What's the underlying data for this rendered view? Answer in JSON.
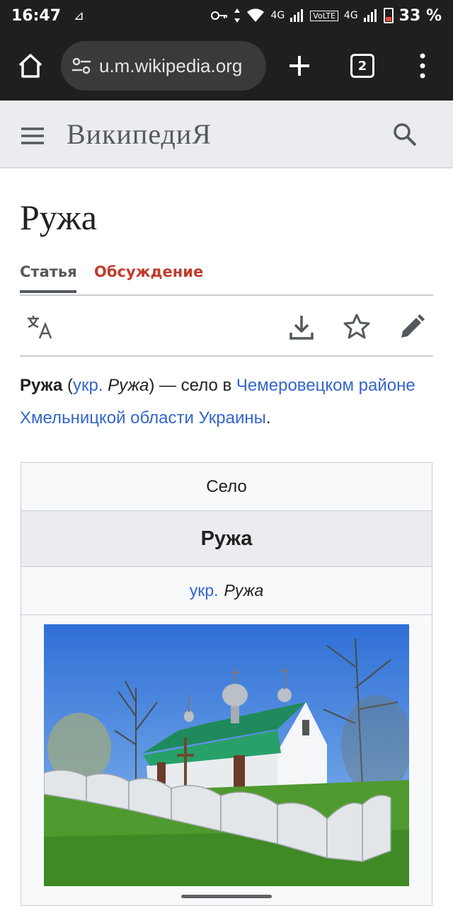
{
  "status_bar": {
    "time": "16:47",
    "speed_glyph": "⊿",
    "network_1": "4G",
    "volte": "VoLTE",
    "network_2": "4G",
    "battery_pct": "33 %",
    "battery_level": 0.33
  },
  "browser": {
    "url": "u.m.wikipedia.org",
    "tab_count": "2"
  },
  "wiki_header": {
    "logo_text": "ВикипедиЯ"
  },
  "article": {
    "title": "Ружа",
    "tabs": [
      {
        "label": "Статья"
      },
      {
        "label": "Обсуждение"
      }
    ],
    "lead": {
      "bold_name": "Ружа",
      "paren_open": " (",
      "lang_link": "укр.",
      "lang_term": "Ружа",
      "paren_close": ") — село в ",
      "link_1": "Чемеровецком районе",
      "space": " ",
      "link_2": "Хмельницкой области",
      "space_2": " ",
      "link_3": "Украины",
      "period": "."
    }
  },
  "infobox": {
    "type": "Село",
    "name": "Ружа",
    "local_lang": "укр.",
    "local_name": "Ружа"
  },
  "colors": {
    "link": "#3366cc",
    "talk_tab": "#bf3c2c",
    "header_bg": "#eaecf0",
    "browser_bg": "#1f1f1f"
  }
}
